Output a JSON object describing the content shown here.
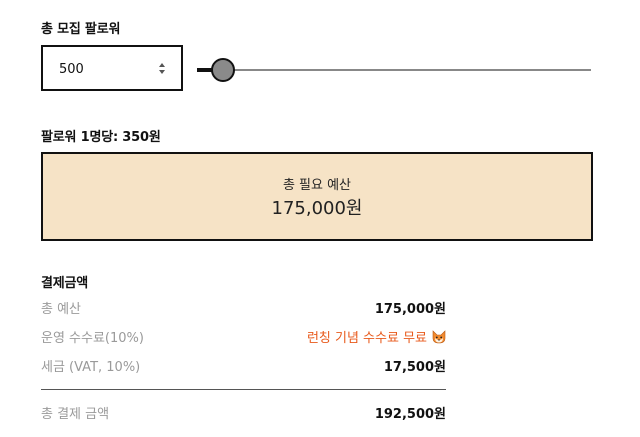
{
  "followers": {
    "title": "총 모집 팔로워",
    "value": "500",
    "slider": {
      "min": 0,
      "max": 100000,
      "value": 500
    }
  },
  "price_per_follower": "팔로워 1명당: 350원",
  "budget_box": {
    "label": "총 필요 예산",
    "amount": "175,000원"
  },
  "payment": {
    "title": "결제금액",
    "rows": [
      {
        "label": "총 예산",
        "value": "175,000원"
      },
      {
        "label": "운영 수수료(10%)",
        "value": "런칭 기념 수수료 무료",
        "icon": "fox-face-icon"
      },
      {
        "label": "세금 (VAT, 10%)",
        "value": "17,500원"
      }
    ],
    "total": {
      "label": "총 결제 금액",
      "value": "192,500원"
    }
  },
  "colors": {
    "budget_background": "#f6e3c6",
    "promo_text": "#e85a1c",
    "label_gray": "#9a9a9a"
  }
}
